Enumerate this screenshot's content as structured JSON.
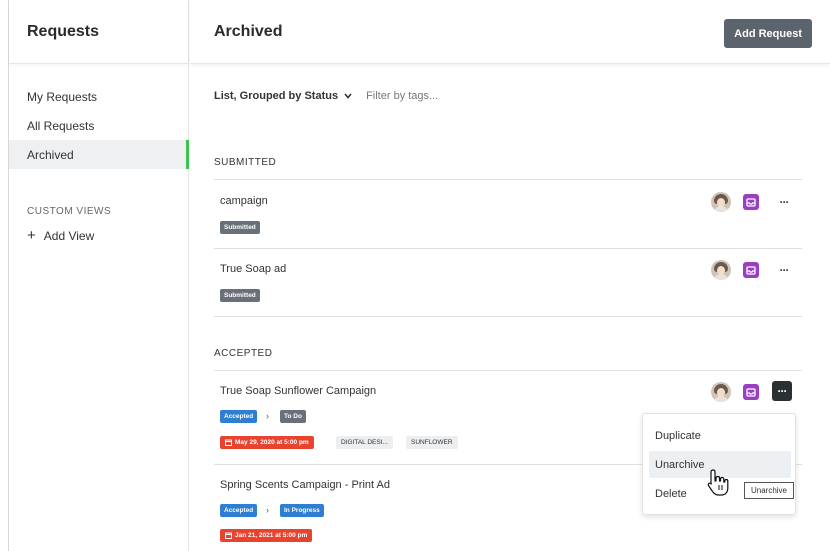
{
  "sidebar": {
    "title": "Requests",
    "items": [
      {
        "label": "My Requests",
        "active": false
      },
      {
        "label": "All Requests",
        "active": false
      },
      {
        "label": "Archived",
        "active": true
      }
    ],
    "custom_views_label": "CUSTOM VIEWS",
    "add_view_label": "Add View",
    "active_accent": "#3cc24e"
  },
  "header": {
    "title": "Archived",
    "add_request_label": "Add Request"
  },
  "toolbar": {
    "view_mode": "List, Grouped by Status",
    "filter_placeholder": "Filter by tags..."
  },
  "groups": [
    {
      "label": "SUBMITTED",
      "rows": [
        {
          "title": "campaign",
          "status": "Submitted"
        },
        {
          "title": "True Soap ad",
          "status": "Submitted"
        }
      ]
    },
    {
      "label": "ACCEPTED",
      "rows": [
        {
          "title": "True Soap Sunflower Campaign",
          "status": "Accepted",
          "stage": "To Do",
          "due": "May 29, 2020 at 5:00 pm",
          "tags": [
            "DIGITAL DESI...",
            "SUNFLOWER"
          ]
        },
        {
          "title": "Spring Scents Campaign - Print Ad",
          "status": "Accepted",
          "stage": "In Progress",
          "due": "Jan 21, 2021 at 5:00 pm"
        }
      ]
    }
  ],
  "context_menu": {
    "items": [
      "Duplicate",
      "Unarchive",
      "Delete"
    ],
    "hovered": "Unarchive",
    "tooltip": "Unarchive"
  },
  "icons": {
    "more": "more-horizontal-icon",
    "archive_tray": "inbox-tray-icon",
    "chevron": "chevron-down-icon",
    "plus": "plus-icon",
    "calendar": "calendar-icon",
    "cursor": "hand-pointer-icon"
  },
  "colors": {
    "submitted": "#6a7079",
    "accepted": "#2e7fd1",
    "due_date": "#e8432f",
    "tray": "#9a3fc2",
    "primary_button": "#5b646c"
  },
  "glyphs": {
    "more": "···",
    "arrow": "›",
    "chevron": "⌄",
    "plus": "+"
  }
}
